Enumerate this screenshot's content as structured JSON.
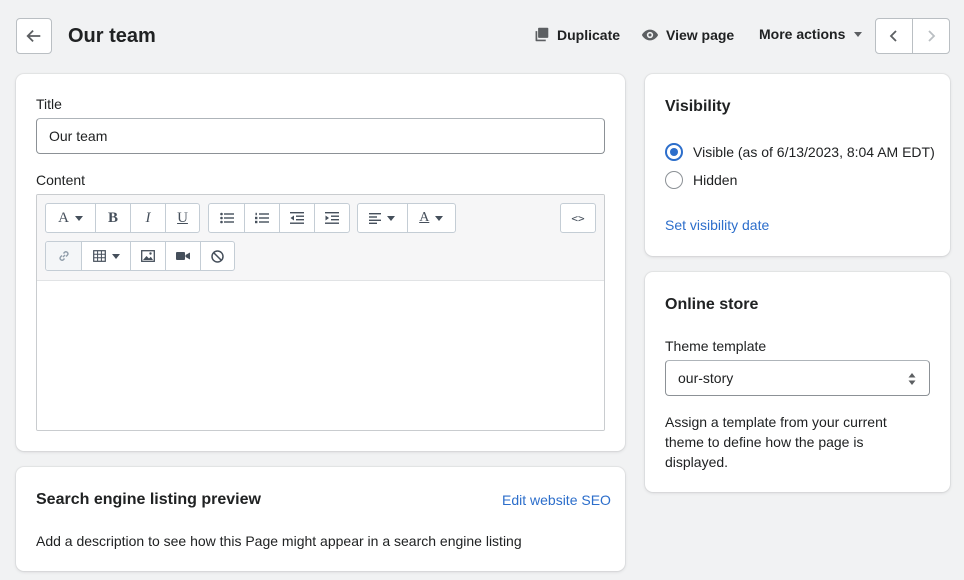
{
  "header": {
    "title": "Our team",
    "actions": {
      "duplicate": "Duplicate",
      "view_page": "View page",
      "more_actions": "More actions"
    }
  },
  "main_card": {
    "title_label": "Title",
    "title_value": "Our team",
    "content_label": "Content",
    "toolbar": {
      "row1": [
        "font",
        "bold",
        "italic",
        "underline",
        "bullet-list",
        "numbered-list",
        "outdent",
        "indent",
        "align",
        "text-color",
        "html-source"
      ],
      "row2": [
        "link",
        "table",
        "image",
        "video",
        "clear-formatting"
      ],
      "glyphs": {
        "font": "A",
        "bold": "B",
        "italic": "I",
        "underline": "U",
        "text_color": "A",
        "source": "<>"
      }
    }
  },
  "seo_card": {
    "heading": "Search engine listing preview",
    "edit_link": "Edit website SEO",
    "description": "Add a description to see how this Page might appear in a search engine listing"
  },
  "visibility_card": {
    "heading": "Visibility",
    "options": [
      {
        "label": "Visible (as of 6/13/2023, 8:04 AM EDT)",
        "selected": true
      },
      {
        "label": "Hidden",
        "selected": false
      }
    ],
    "set_date_link": "Set visibility date"
  },
  "online_store_card": {
    "heading": "Online store",
    "template_label": "Theme template",
    "template_value": "our-story",
    "help_text": "Assign a template from your current theme to define how the page is displayed."
  },
  "colors": {
    "accent": "#2c6ecb",
    "background": "#f1f2f3",
    "text": "#202223"
  }
}
